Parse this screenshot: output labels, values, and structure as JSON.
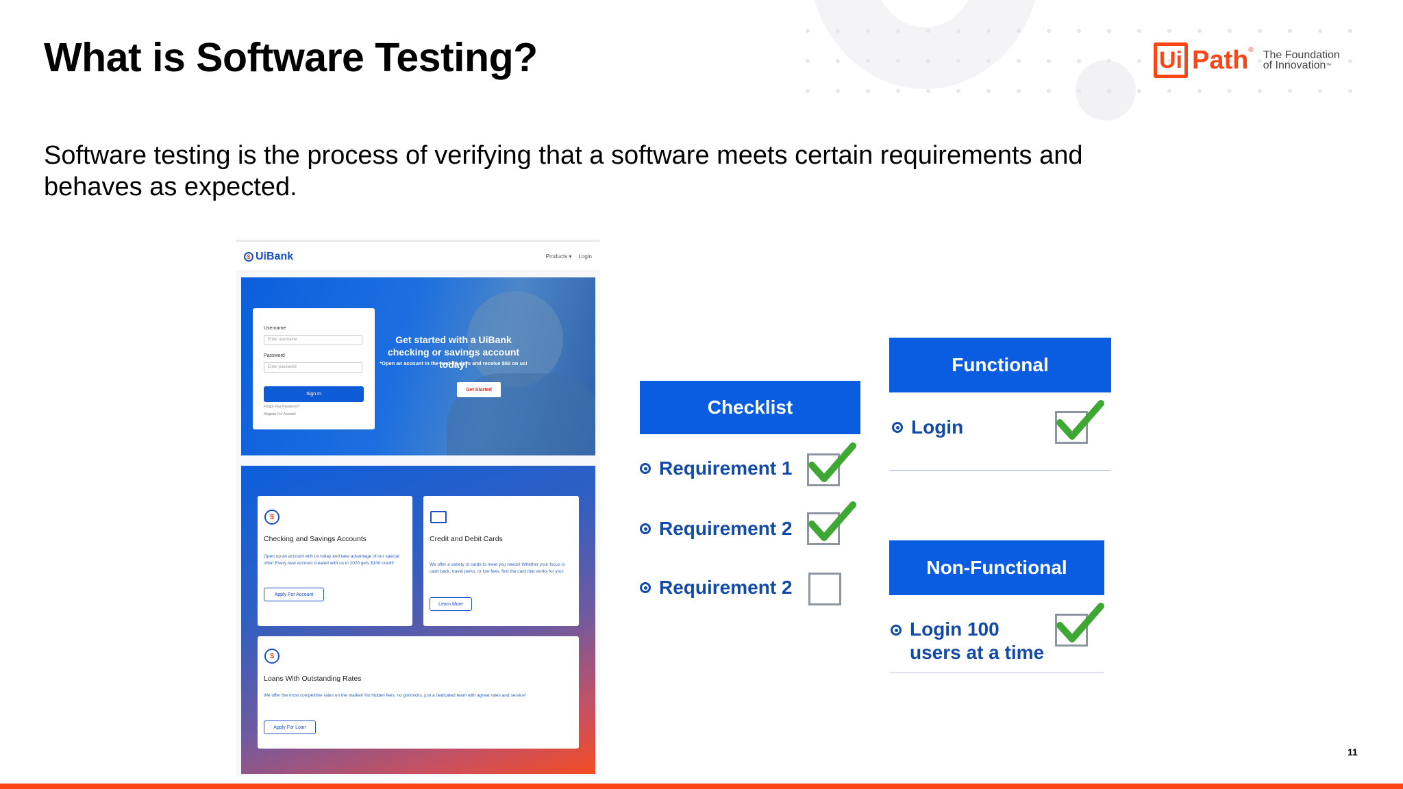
{
  "slide": {
    "title": "What is Software Testing?",
    "body": "Software testing is the process of verifying that a software meets certain requirements and behaves as expected.",
    "page_number": "11"
  },
  "logo": {
    "ui": "Ui",
    "path": "Path",
    "reg": "®",
    "tagline_1": "The Foundation",
    "tagline_2": "of Innovation",
    "tm": "™",
    "brand_color": "#fa4616"
  },
  "uibank": {
    "brand": "UiBank",
    "coin": "$",
    "nav": {
      "products": "Products ▾",
      "login": "Login"
    },
    "login": {
      "username_label": "Username",
      "username_placeholder": "Enter username",
      "password_label": "Password",
      "password_placeholder": "Enter password",
      "sign_in": "Sign In",
      "forgot": "Forgot Your Password?",
      "register": "Register For Account"
    },
    "hero": {
      "headline": "Get started with a UiBank checking or savings account today!",
      "subtext": "*Open an account in the next 30 days and receive $50 on us!",
      "button": "Get Started"
    },
    "products": [
      {
        "icon": "$",
        "title": "Checking and Savings Accounts",
        "text": "Open up an account with us today and take advantage of our special offer! Every new account created with us in 2020 gets $100 credit!",
        "button": "Apply For Account"
      },
      {
        "icon": "card-icon",
        "title": "Credit and Debit Cards",
        "text": "We offer a variety of cards to meet you needs! Whether your focus is cash back, travel perks, or low fees, find the card that works for you!",
        "button": "Learn More"
      },
      {
        "icon": "$",
        "title": "Loans With Outstanding Rates",
        "text": "We offer the most competitive rates on the market! No hidden fees, no gimmicks, just a dedicated team with agreat rates and service!",
        "button": "Apply For Loan"
      }
    ]
  },
  "checklist": {
    "header": "Checklist",
    "items": [
      {
        "label": "Requirement 1",
        "checked": true
      },
      {
        "label": "Requirement 2",
        "checked": true
      },
      {
        "label": "Requirement 2",
        "checked": false
      }
    ]
  },
  "functional": {
    "header": "Functional",
    "item": "Login",
    "checked": true
  },
  "non_functional": {
    "header": "Non-Functional",
    "item_line1": "Login 100",
    "item_line2": "users at a time",
    "checked": true
  },
  "colors": {
    "header_blue": "#0a5ce0",
    "text_blue": "#124aa8",
    "check_green": "#3fa835",
    "accent_orange": "#fa4616"
  }
}
